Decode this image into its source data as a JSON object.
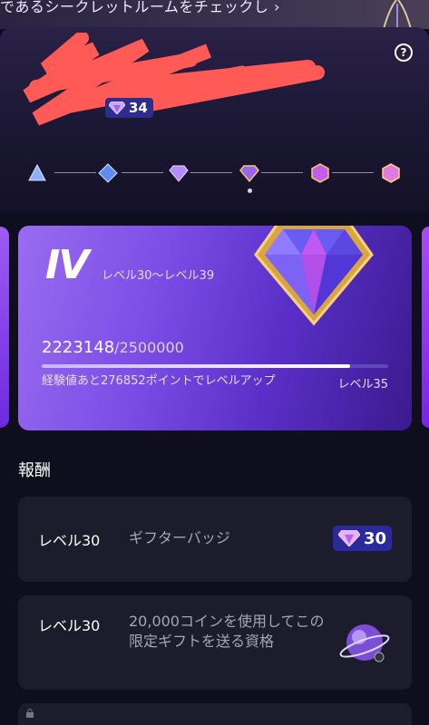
{
  "banner": {
    "text": "であるシークレットルームをチェックし ›"
  },
  "header": {
    "help_icon": "?",
    "gem_count": "34"
  },
  "tiers": [
    "tier-1-icon",
    "tier-2-icon",
    "tier-3-icon",
    "tier-4-icon",
    "tier-5-icon",
    "tier-6-icon"
  ],
  "card": {
    "tier": "IV",
    "range": "レベル30〜レベル39",
    "xp_current": "2223148",
    "xp_total": "/2500000",
    "progress": 0.889,
    "hint": "経験値あと276852ポイントでレベルアップ",
    "next_level": "レベル35"
  },
  "rewards": {
    "title": "報酬",
    "items": [
      {
        "level": "レベル30",
        "description": "ギフターバッジ",
        "badge_value": "30"
      },
      {
        "level": "レベル30",
        "description": "20,000コインを使用してこの限定ギフトを送る資格"
      }
    ]
  },
  "colors": {
    "accent": "#7b4de6",
    "card_bg": "#1d1c2c",
    "badge_bg": "#2b2a9a",
    "redaction": "#ff5a55"
  }
}
